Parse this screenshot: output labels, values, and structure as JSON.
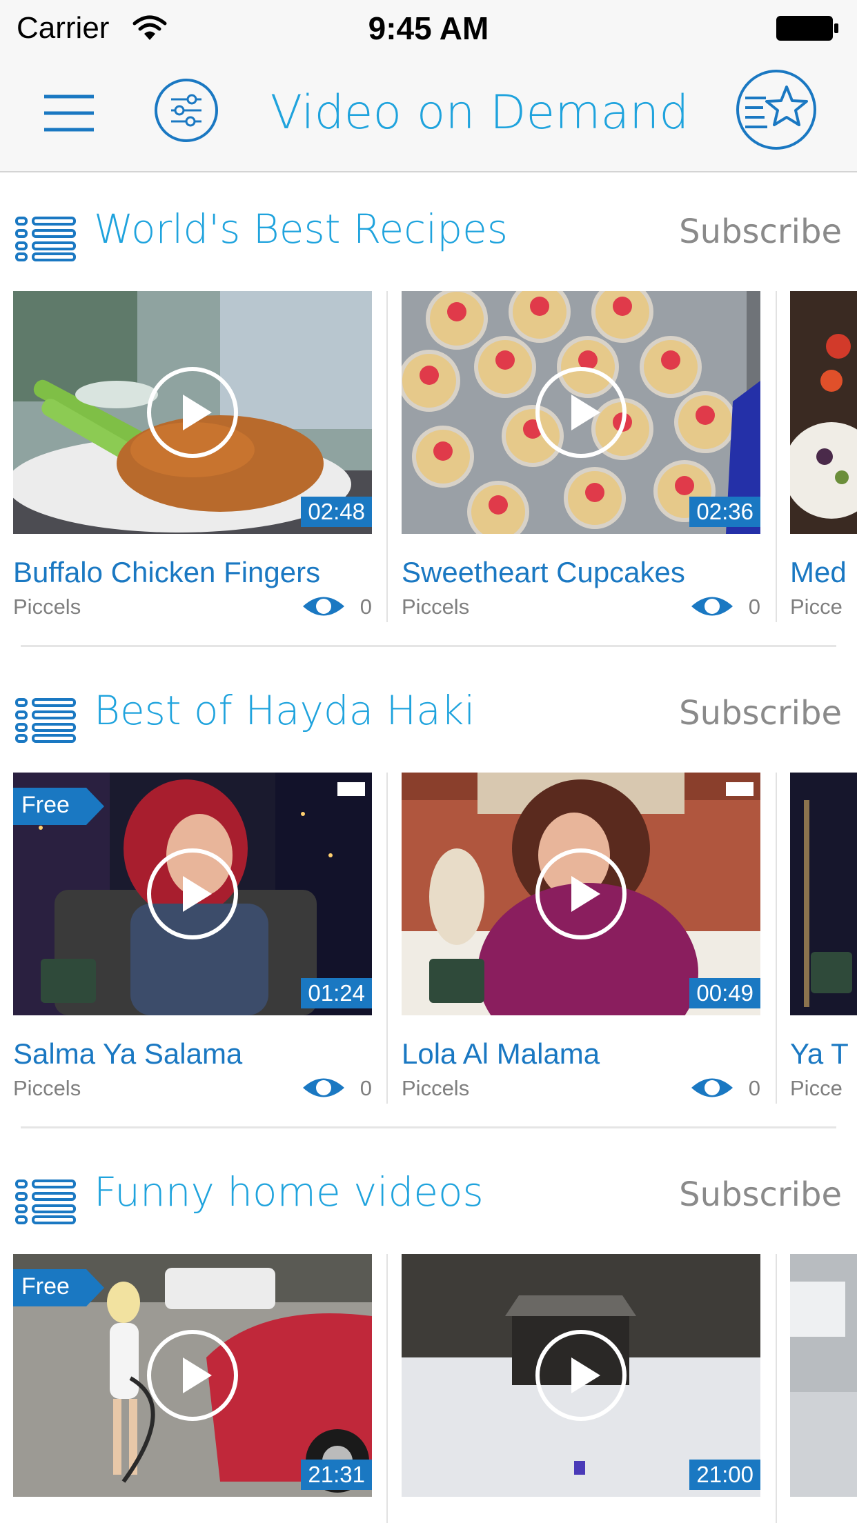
{
  "status_bar": {
    "carrier": "Carrier",
    "time": "9:45 AM"
  },
  "header": {
    "title": "Video on Demand"
  },
  "icons": {
    "menu": "hamburger-icon",
    "filter": "sliders-icon",
    "favorites": "starred-list-icon",
    "section": "list-icon",
    "play": "play-icon",
    "views": "eye-icon"
  },
  "colors": {
    "accent": "#1fa3dd",
    "primary": "#1a78c2",
    "muted": "#8a8a8a"
  },
  "sections": [
    {
      "title": "World's Best Recipes",
      "subscribe": "Subscribe",
      "videos": [
        {
          "title": "Buffalo Chicken Fingers",
          "author": "Piccels",
          "views": "0",
          "duration": "02:48",
          "free": ""
        },
        {
          "title": "Sweetheart Cupcakes",
          "author": "Piccels",
          "views": "0",
          "duration": "02:36",
          "free": ""
        },
        {
          "title": "Med",
          "author": "Picce",
          "views": "",
          "duration": "",
          "free": ""
        }
      ]
    },
    {
      "title": "Best of Hayda Haki",
      "subscribe": "Subscribe",
      "videos": [
        {
          "title": "Salma Ya Salama",
          "author": "Piccels",
          "views": "0",
          "duration": "01:24",
          "free": "Free"
        },
        {
          "title": "Lola Al Malama",
          "author": "Piccels",
          "views": "0",
          "duration": "00:49",
          "free": ""
        },
        {
          "title": "Ya T",
          "author": "Picce",
          "views": "",
          "duration": "",
          "free": ""
        }
      ]
    },
    {
      "title": "Funny home videos",
      "subscribe": "Subscribe",
      "videos": [
        {
          "title": "",
          "author": "",
          "views": "",
          "duration": "21:31",
          "free": "Free"
        },
        {
          "title": "",
          "author": "",
          "views": "",
          "duration": "21:00",
          "free": ""
        },
        {
          "title": "",
          "author": "",
          "views": "",
          "duration": "",
          "free": ""
        }
      ]
    }
  ]
}
